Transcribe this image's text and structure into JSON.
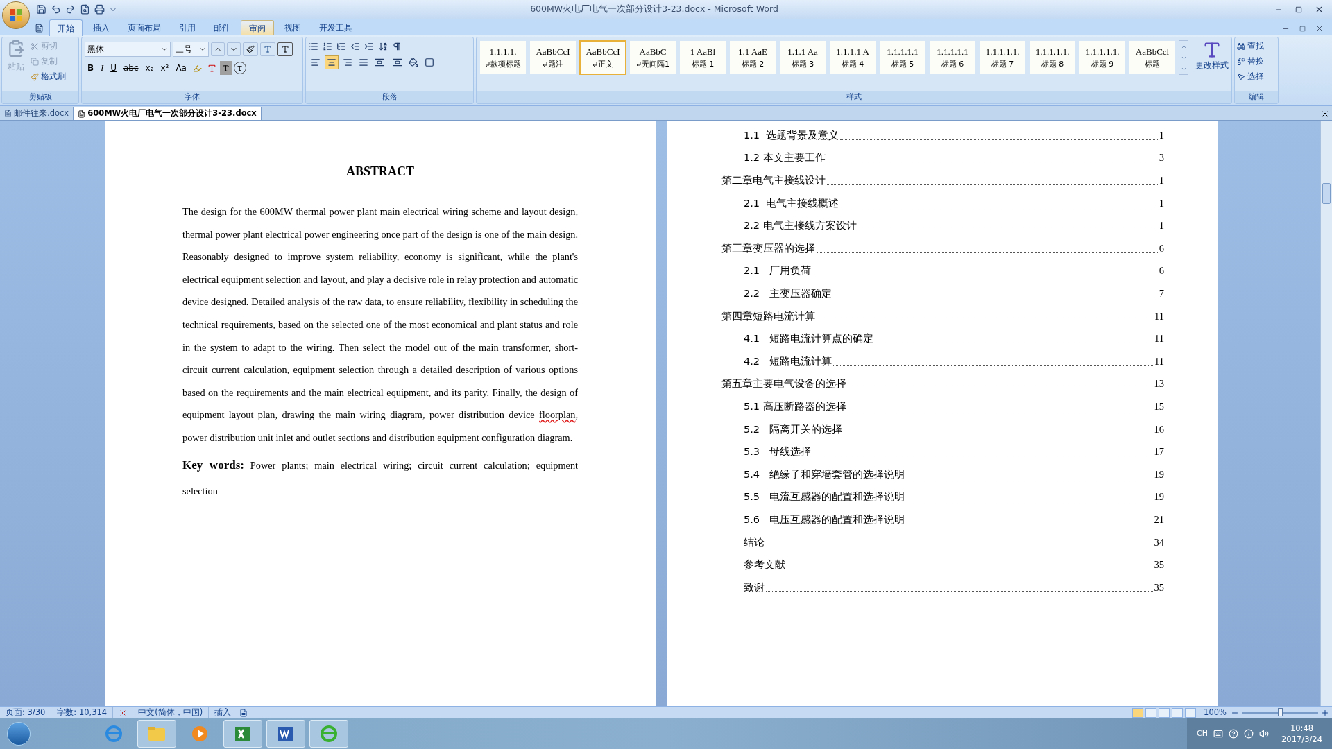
{
  "window": {
    "title": "600MW火电厂电气一次部分设计3-23.docx - Microsoft Word"
  },
  "ribbon_tabs": [
    {
      "label": "开始",
      "selected": true,
      "highlighted": false
    },
    {
      "label": "插入",
      "selected": false,
      "highlighted": false
    },
    {
      "label": "页面布局",
      "selected": false,
      "highlighted": false
    },
    {
      "label": "引用",
      "selected": false,
      "highlighted": false
    },
    {
      "label": "邮件",
      "selected": false,
      "highlighted": false
    },
    {
      "label": "审阅",
      "selected": false,
      "highlighted": true
    },
    {
      "label": "视图",
      "selected": false,
      "highlighted": false
    },
    {
      "label": "开发工具",
      "selected": false,
      "highlighted": false
    }
  ],
  "clipboard": {
    "title": "剪贴板",
    "paste": {
      "label": "粘贴",
      "disabled": true
    },
    "items": [
      {
        "label": "剪切",
        "disabled": true
      },
      {
        "label": "复制",
        "disabled": true
      },
      {
        "label": "格式刷",
        "disabled": false
      }
    ]
  },
  "font": {
    "title": "字体",
    "font_name": "黑体",
    "font_size": "三号",
    "format_buttons": [
      {
        "label": "B",
        "kind": "bold"
      },
      {
        "label": "I",
        "kind": "italic"
      },
      {
        "label": "U",
        "kind": "underline"
      },
      {
        "label": "abc",
        "kind": "strike"
      },
      {
        "label": "x₂",
        "kind": "plain"
      },
      {
        "label": "x²",
        "kind": "plain"
      },
      {
        "label": "Aa",
        "kind": "plain"
      }
    ]
  },
  "paragraph": {
    "title": "段落",
    "alignments": [
      {
        "selected": false
      },
      {
        "selected": true
      },
      {
        "selected": false
      },
      {
        "selected": false
      },
      {
        "selected": false
      }
    ]
  },
  "styles": {
    "title": "样式",
    "change_styles": "更改样式",
    "gallery": [
      {
        "preview": "1.1.1.1.",
        "label": "款项标题",
        "paragraph_mark": true,
        "selected": false
      },
      {
        "preview": "AaBbCcI",
        "label": "题注",
        "paragraph_mark": true,
        "selected": false
      },
      {
        "preview": "AaBbCcI",
        "label": "正文",
        "paragraph_mark": true,
        "selected": true
      },
      {
        "preview": "AaBbC",
        "label": "无间隔1",
        "paragraph_mark": true,
        "selected": false
      },
      {
        "preview": "1 AaBl",
        "label": "标题 1",
        "paragraph_mark": false,
        "selected": false
      },
      {
        "preview": "1.1 AaE",
        "label": "标题 2",
        "paragraph_mark": false,
        "selected": false
      },
      {
        "preview": "1.1.1 Aa",
        "label": "标题 3",
        "paragraph_mark": false,
        "selected": false
      },
      {
        "preview": "1.1.1.1 A",
        "label": "标题 4",
        "paragraph_mark": false,
        "selected": false
      },
      {
        "preview": "1.1.1.1.1",
        "label": "标题 5",
        "paragraph_mark": false,
        "selected": false
      },
      {
        "preview": "1.1.1.1.1",
        "label": "标题 6",
        "paragraph_mark": false,
        "selected": false
      },
      {
        "preview": "1.1.1.1.1.",
        "label": "标题 7",
        "paragraph_mark": false,
        "selected": false
      },
      {
        "preview": "1.1.1.1.1.",
        "label": "标题 8",
        "paragraph_mark": false,
        "selected": false
      },
      {
        "preview": "1.1.1.1.1.",
        "label": "标题 9",
        "paragraph_mark": false,
        "selected": false
      },
      {
        "preview": "AaBbCcl",
        "label": "标题",
        "paragraph_mark": false,
        "selected": false
      }
    ]
  },
  "editing": {
    "title": "编辑",
    "items": [
      "查找",
      "替换",
      "选择"
    ]
  },
  "document_tabs": [
    {
      "label": "邮件往来.docx",
      "selected": false
    },
    {
      "label": "600MW火电厂电气一次部分设计3-23.docx",
      "selected": true
    }
  ],
  "left_page": {
    "heading": "ABSTRACT",
    "body": [
      {
        "text": "The design for the 600MW thermal power plant main electrical wiring scheme and layout design, thermal power plant electrical power engineering once part of the design is one of the main design. Reasonably designed to improve system reliability, economy is significant, while the plant's electrical equipment selection and layout, and play a decisive role in relay protection and automatic device designed. Detailed analysis of the raw data, to ensure reliability, flexibility in scheduling the technical requirements, based on the selected one of the most economical and plant status and role in the system to adapt to the wiring. Then select the model out of the main transformer, short-circuit current calculation, equipment selection through a detailed description of various options based on the requirements and the main electrical equipment, and its parity. Finally, the design of equipment layout plan, drawing the main wiring diagram, power distribution device ",
        "misspelled": false
      },
      {
        "text": "floorplan",
        "misspelled": true
      },
      {
        "text": ", power distribution unit inlet and outlet sections and distribution equipment configuration diagram.",
        "misspelled": false
      }
    ],
    "keywords": "**Key words:** Power plants; main electrical wiring; circuit current calculation; equipment selection"
  },
  "toc": [
    {
      "children": [
        {
          "title": "1.1  选题背景及意义",
          "page": "1"
        },
        {
          "title": "1.2 本文主要工作",
          "page": "3"
        }
      ]
    },
    {
      "title": "第二章电气主接线设计",
      "page": "1",
      "children": [
        {
          "title": "2.1  电气主接线概述",
          "page": "1"
        },
        {
          "title": "2.2 电气主接线方案设计",
          "page": "1"
        }
      ]
    },
    {
      "title": "第三章变压器的选择",
      "page": "6",
      "children": [
        {
          "title": "2.1   厂用负荷",
          "page": "6"
        },
        {
          "title": "2.2   主变压器确定",
          "page": "7"
        }
      ]
    },
    {
      "title": "第四章短路电流计算",
      "page": "11",
      "children": [
        {
          "title": "4.1   短路电流计算点的确定",
          "page": "11"
        },
        {
          "title": "4.2   短路电流计算",
          "page": "11"
        }
      ]
    },
    {
      "title": "第五章主要电气设备的选择",
      "page": "13",
      "children": [
        {
          "title": "5.1 高压断路器的选择",
          "page": "15"
        },
        {
          "title": "5.2   隔离开关的选择",
          "page": "16"
        },
        {
          "title": "5.3   母线选择",
          "page": "17"
        },
        {
          "title": "5.4   绝缘子和穿墙套管的选择说明",
          "page": "19"
        },
        {
          "title": "5.5   电流互感器的配置和选择说明",
          "page": "19"
        },
        {
          "title": "5.6   电压互感器的配置和选择说明",
          "page": "21"
        }
      ]
    },
    {
      "children": [
        {
          "title": "结论",
          "page": "34"
        },
        {
          "title": "参考文献",
          "page": "35"
        },
        {
          "title": "致谢",
          "page": "35"
        }
      ]
    }
  ],
  "status_bar": {
    "page": "页面: 3/30",
    "words": "字数: 10,314",
    "language": "中文(简体，中国)",
    "mode": "插入",
    "zoom": "100%",
    "zoom_slider": {
      "level": 0.5
    }
  },
  "tray": {
    "input": "CH",
    "time": "10:48",
    "date": "2017/3/24"
  }
}
